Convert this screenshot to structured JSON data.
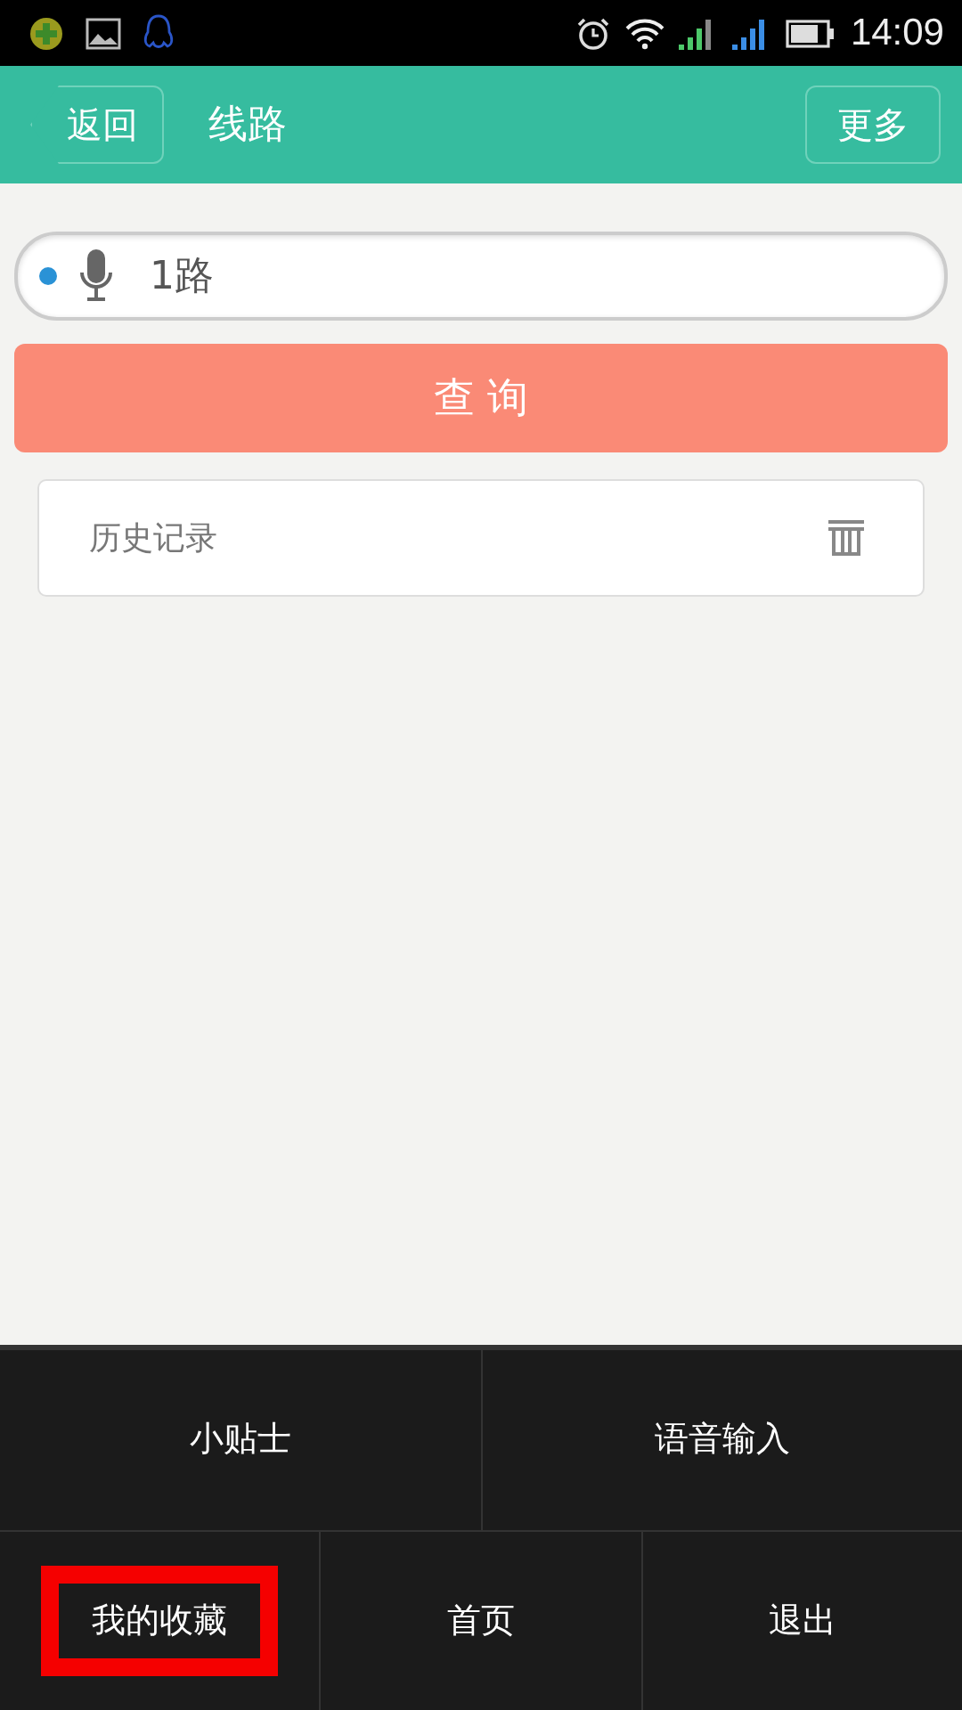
{
  "status_bar": {
    "time": "14:09"
  },
  "header": {
    "back": "返回",
    "title": "线路",
    "more": "更多"
  },
  "search": {
    "value": "1路"
  },
  "query_button": "查 询",
  "history": {
    "label": "历史记录"
  },
  "menu": {
    "rows": [
      [
        {
          "label": "小贴士",
          "highlighted": false
        },
        {
          "label": "语音输入",
          "highlighted": false
        }
      ],
      [
        {
          "label": "我的收藏",
          "highlighted": true
        },
        {
          "label": "首页",
          "highlighted": false
        },
        {
          "label": "退出",
          "highlighted": false
        }
      ]
    ]
  }
}
